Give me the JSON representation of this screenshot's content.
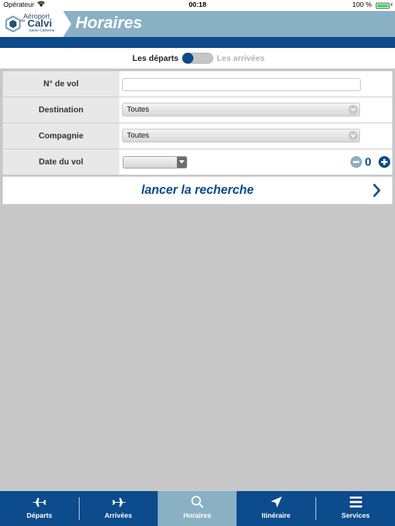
{
  "status_bar": {
    "carrier": "Opérateur",
    "time": "00:18",
    "battery": "100 %"
  },
  "header": {
    "logo": {
      "line1": "Aéroport",
      "line2": "de",
      "line3": "Calvi",
      "line4": "Sainte-Catherine"
    },
    "title": "Horaires"
  },
  "toggle": {
    "departures": "Les départs",
    "arrivals": "Les arrivées",
    "selected": "departures"
  },
  "form": {
    "flight_number": {
      "label": "N° de vol",
      "value": "",
      "placeholder": ""
    },
    "destination": {
      "label": "Destination",
      "value": "Toutes"
    },
    "company": {
      "label": "Compagnie",
      "value": "Toutes"
    },
    "flight_date": {
      "label": "Date du vol",
      "value": "",
      "offset": "0"
    }
  },
  "search": {
    "label": "lancer la recherche",
    "arrow": "❯"
  },
  "tabs": [
    {
      "label": "Départs",
      "icon": "plane-departure-icon"
    },
    {
      "label": "Arrivées",
      "icon": "plane-arrival-icon"
    },
    {
      "label": "Horaires",
      "icon": "search-icon",
      "active": true
    },
    {
      "label": "Itinéraire",
      "icon": "navigation-arrow-icon"
    },
    {
      "label": "Services",
      "icon": "menu-icon"
    }
  ],
  "colors": {
    "primary": "#0c4b8c",
    "header": "#8ab0c4",
    "background": "#c8c8c8"
  }
}
